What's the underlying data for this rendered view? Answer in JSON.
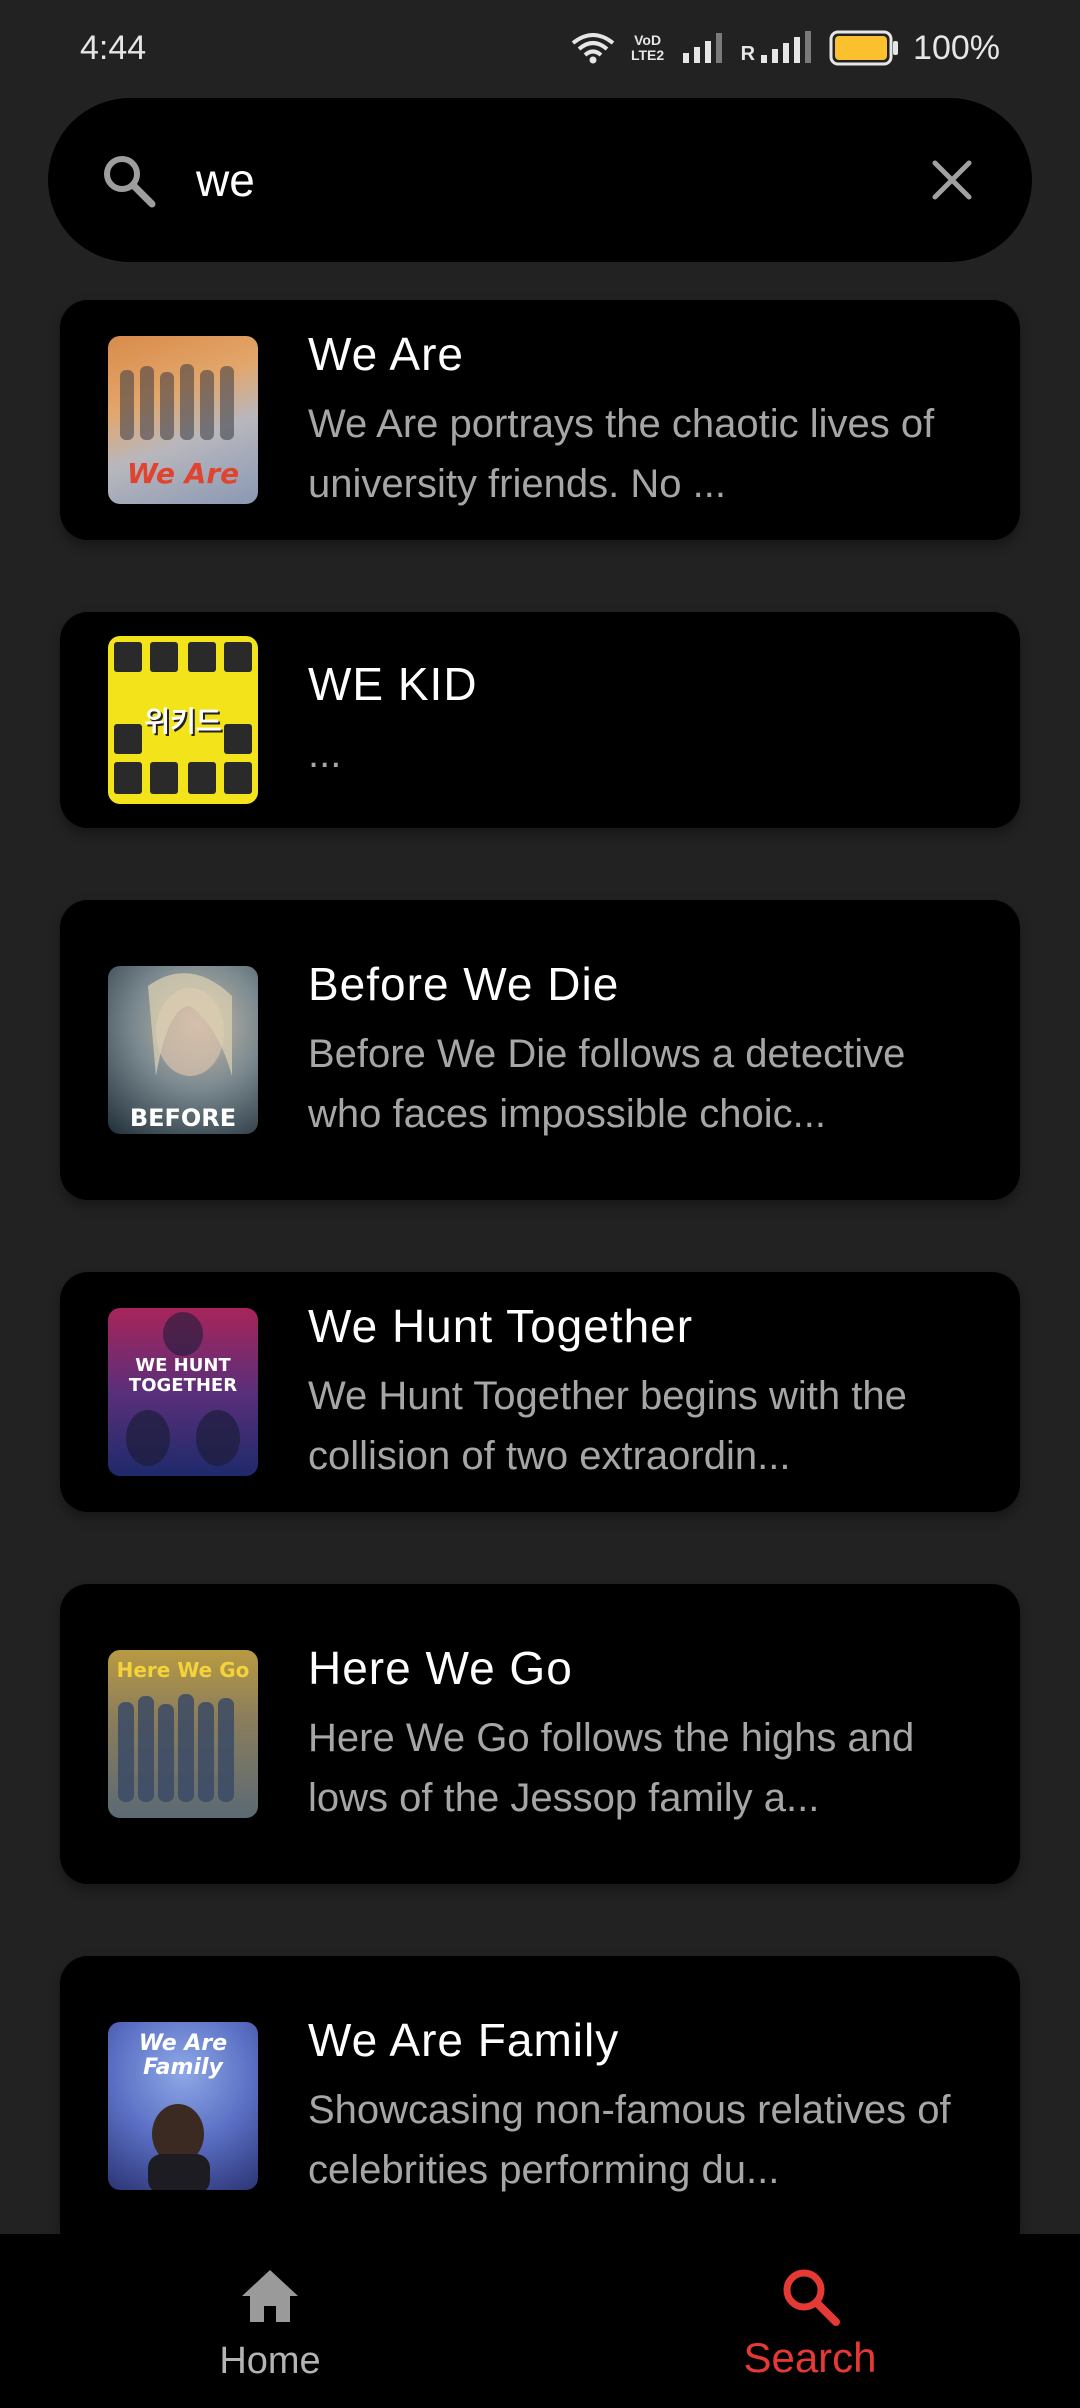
{
  "status_bar": {
    "time": "4:44",
    "network_label": "VoD LTE2",
    "roaming_label": "R",
    "battery_percent": "100%",
    "battery_level": 1.0
  },
  "search": {
    "value": "we",
    "placeholder": ""
  },
  "results": [
    {
      "title": "We Are",
      "description": "We Are portrays the chaotic lives of university friends. No ...",
      "thumbnail": "We Are"
    },
    {
      "title": "WE KID",
      "description": "...",
      "thumbnail": "위키드"
    },
    {
      "title": "Before We Die",
      "description": "Before We Die follows a detective who faces impossible choic...",
      "thumbnail": "BEFORE"
    },
    {
      "title": "We Hunt Together",
      "description": "We Hunt Together begins with the collision of two extraordin...",
      "thumbnail": "WE HUNT TOGETHER"
    },
    {
      "title": "Here We Go",
      "description": "Here We Go follows the highs and lows of the Jessop family a...",
      "thumbnail": "Here We Go"
    },
    {
      "title": "We Are Family",
      "description": "Showcasing non-famous relatives of celebrities performing du...",
      "thumbnail": "We Are Family"
    }
  ],
  "bottom_nav": {
    "items": [
      {
        "label": "Home",
        "icon": "home-icon",
        "active": false
      },
      {
        "label": "Search",
        "icon": "search-icon",
        "active": true
      }
    ]
  },
  "colors": {
    "background": "#222222",
    "surface": "#000000",
    "accent": "#e53935",
    "battery": "#fbc02d",
    "text_secondary": "#a6a6a6"
  }
}
